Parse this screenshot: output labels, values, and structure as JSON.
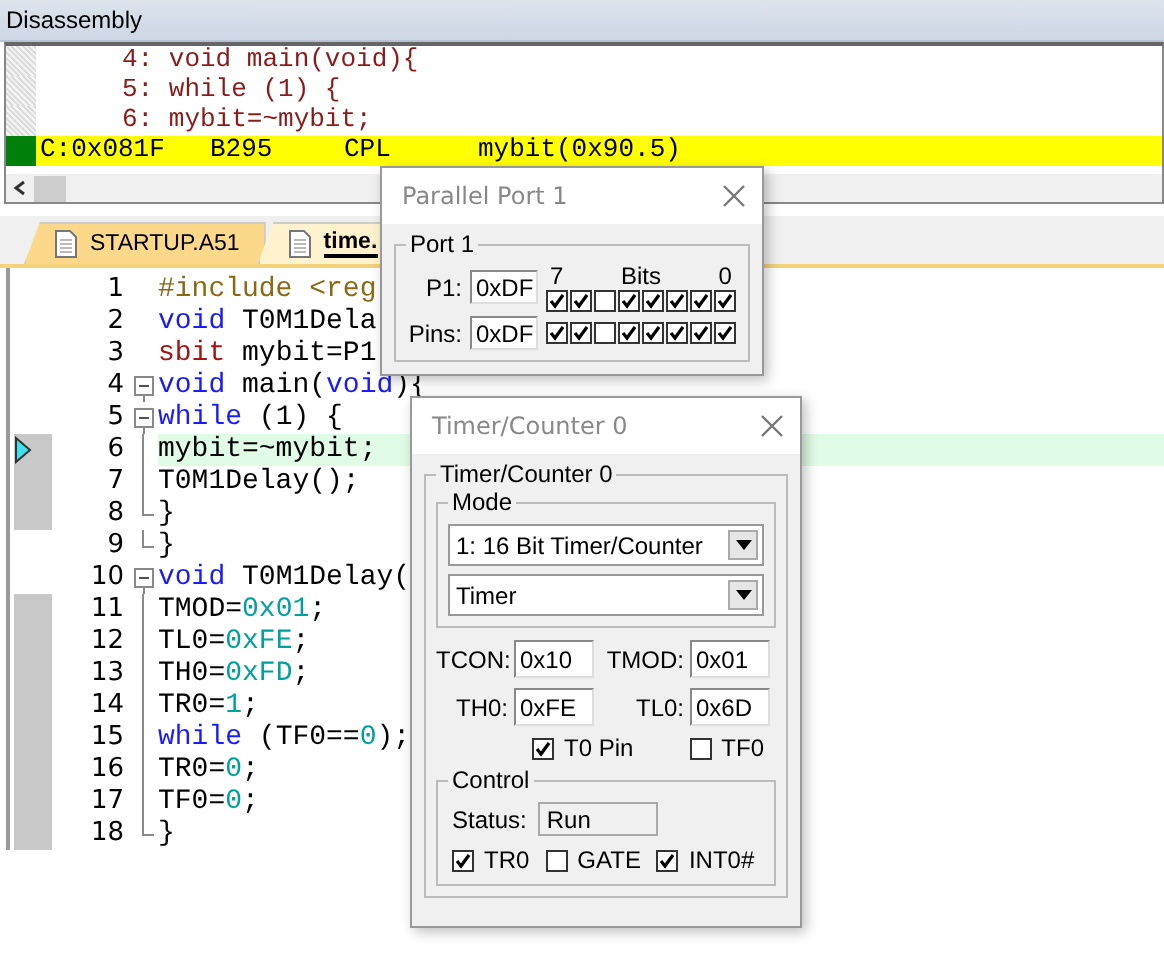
{
  "disassembly": {
    "title": "Disassembly",
    "lines": [
      {
        "kind": "source",
        "text": "4: void main(void){"
      },
      {
        "kind": "source",
        "text": "5: while (1) {"
      },
      {
        "kind": "source",
        "text": "6: mybit=~mybit;"
      },
      {
        "kind": "instruction",
        "address": "C:0x081F",
        "opcode": "B295",
        "mnemonic": "CPL",
        "operand": "mybit(0x90.5)",
        "current": true
      }
    ]
  },
  "editor": {
    "tabs": [
      {
        "label": "STARTUP.A51",
        "selected": false
      },
      {
        "label": "time.",
        "selected": true
      }
    ],
    "lines": [
      {
        "number": "1",
        "kind": "plain",
        "covered": false,
        "current": false,
        "tokens": [
          {
            "kind": "preproc",
            "text": "#include <reg"
          }
        ]
      },
      {
        "number": "2",
        "kind": "plain",
        "covered": false,
        "current": false,
        "tokens": [
          {
            "kind": "keyword",
            "text": "void"
          },
          {
            "kind": "plain",
            "text": " T0M1Dela"
          }
        ]
      },
      {
        "number": "3",
        "kind": "plain",
        "covered": false,
        "current": false,
        "tokens": [
          {
            "kind": "type",
            "text": "sbit"
          },
          {
            "kind": "plain",
            "text": " mybit=P1"
          }
        ]
      },
      {
        "number": "4",
        "kind": "fold-start",
        "covered": false,
        "current": false,
        "tokens": [
          {
            "kind": "keyword",
            "text": "void"
          },
          {
            "kind": "plain",
            "text": " main("
          },
          {
            "kind": "keyword",
            "text": "void"
          },
          {
            "kind": "plain",
            "text": "){"
          }
        ]
      },
      {
        "number": "5",
        "kind": "fold-start",
        "covered": false,
        "current": false,
        "tokens": [
          {
            "kind": "keyword",
            "text": "while"
          },
          {
            "kind": "plain",
            "text": " (1) {"
          }
        ]
      },
      {
        "number": "6",
        "kind": "fold-body",
        "covered": true,
        "current": true,
        "tokens": [
          {
            "kind": "plain",
            "text": "mybit=~mybit;"
          }
        ]
      },
      {
        "number": "7",
        "kind": "fold-body",
        "covered": true,
        "current": false,
        "tokens": [
          {
            "kind": "plain",
            "text": "T0M1Delay();"
          }
        ]
      },
      {
        "number": "8",
        "kind": "fold-end",
        "covered": true,
        "current": false,
        "tokens": [
          {
            "kind": "plain",
            "text": "}"
          }
        ]
      },
      {
        "number": "9",
        "kind": "fold-end",
        "covered": false,
        "current": false,
        "tokens": [
          {
            "kind": "plain",
            "text": "}"
          }
        ]
      },
      {
        "number": "10",
        "kind": "fold-start",
        "covered": false,
        "current": false,
        "tokens": [
          {
            "kind": "keyword",
            "text": "void"
          },
          {
            "kind": "plain",
            "text": " T0M1Delay("
          }
        ]
      },
      {
        "number": "11",
        "kind": "fold-body",
        "covered": true,
        "current": false,
        "tokens": [
          {
            "kind": "plain",
            "text": "TMOD="
          },
          {
            "kind": "number",
            "text": "0x01"
          },
          {
            "kind": "plain",
            "text": ";"
          }
        ]
      },
      {
        "number": "12",
        "kind": "fold-body",
        "covered": true,
        "current": false,
        "tokens": [
          {
            "kind": "plain",
            "text": "TL0="
          },
          {
            "kind": "number",
            "text": "0xFE"
          },
          {
            "kind": "plain",
            "text": ";"
          }
        ]
      },
      {
        "number": "13",
        "kind": "fold-body",
        "covered": true,
        "current": false,
        "tokens": [
          {
            "kind": "plain",
            "text": "TH0="
          },
          {
            "kind": "number",
            "text": "0xFD"
          },
          {
            "kind": "plain",
            "text": ";"
          }
        ]
      },
      {
        "number": "14",
        "kind": "fold-body",
        "covered": true,
        "current": false,
        "tokens": [
          {
            "kind": "plain",
            "text": "TR0="
          },
          {
            "kind": "number",
            "text": "1"
          },
          {
            "kind": "plain",
            "text": ";"
          }
        ]
      },
      {
        "number": "15",
        "kind": "fold-body",
        "covered": true,
        "current": false,
        "tokens": [
          {
            "kind": "keyword",
            "text": "while"
          },
          {
            "kind": "plain",
            "text": " (TF0=="
          },
          {
            "kind": "number",
            "text": "0"
          },
          {
            "kind": "plain",
            "text": ");"
          }
        ]
      },
      {
        "number": "16",
        "kind": "fold-body",
        "covered": true,
        "current": false,
        "tokens": [
          {
            "kind": "plain",
            "text": "TR0="
          },
          {
            "kind": "number",
            "text": "0"
          },
          {
            "kind": "plain",
            "text": ";"
          }
        ]
      },
      {
        "number": "17",
        "kind": "fold-body",
        "covered": true,
        "current": false,
        "tokens": [
          {
            "kind": "plain",
            "text": "TF0="
          },
          {
            "kind": "number",
            "text": "0"
          },
          {
            "kind": "plain",
            "text": ";"
          }
        ]
      },
      {
        "number": "18",
        "kind": "fold-end",
        "covered": true,
        "current": false,
        "tokens": [
          {
            "kind": "plain",
            "text": "}"
          }
        ]
      }
    ]
  },
  "parallel_port": {
    "title": "Parallel Port 1",
    "group": "Port 1",
    "high_bit": "7",
    "bits_label": "Bits",
    "low_bit": "0",
    "rows": [
      {
        "label": "P1:",
        "value": "0xDF",
        "bits": [
          {
            "checked": true
          },
          {
            "checked": true
          },
          {
            "checked": false
          },
          {
            "checked": true
          },
          {
            "checked": true
          },
          {
            "checked": true
          },
          {
            "checked": true
          },
          {
            "checked": true
          }
        ]
      },
      {
        "label": "Pins:",
        "value": "0xDF",
        "bits": [
          {
            "checked": true
          },
          {
            "checked": true
          },
          {
            "checked": false
          },
          {
            "checked": true
          },
          {
            "checked": true
          },
          {
            "checked": true
          },
          {
            "checked": true
          },
          {
            "checked": true
          }
        ]
      }
    ]
  },
  "timer": {
    "title": "Timer/Counter 0",
    "group": "Timer/Counter 0",
    "mode_group": "Mode",
    "mode": "1: 16 Bit Timer/Counter",
    "source": "Timer",
    "fields": [
      {
        "label": "TCON:",
        "value": "0x10"
      },
      {
        "label": "TMOD:",
        "value": "0x01"
      },
      {
        "label": "TH0:",
        "value": "0xFE"
      },
      {
        "label": "TL0:",
        "value": "0x6D"
      }
    ],
    "pins": [
      {
        "label": "T0 Pin",
        "checked": true
      },
      {
        "label": "TF0",
        "checked": false
      }
    ],
    "control_group": "Control",
    "status_label": "Status:",
    "status": "Run",
    "controls": [
      {
        "label": "TR0",
        "checked": true
      },
      {
        "label": "GATE",
        "checked": false
      },
      {
        "label": "INT0#",
        "checked": true
      }
    ]
  }
}
